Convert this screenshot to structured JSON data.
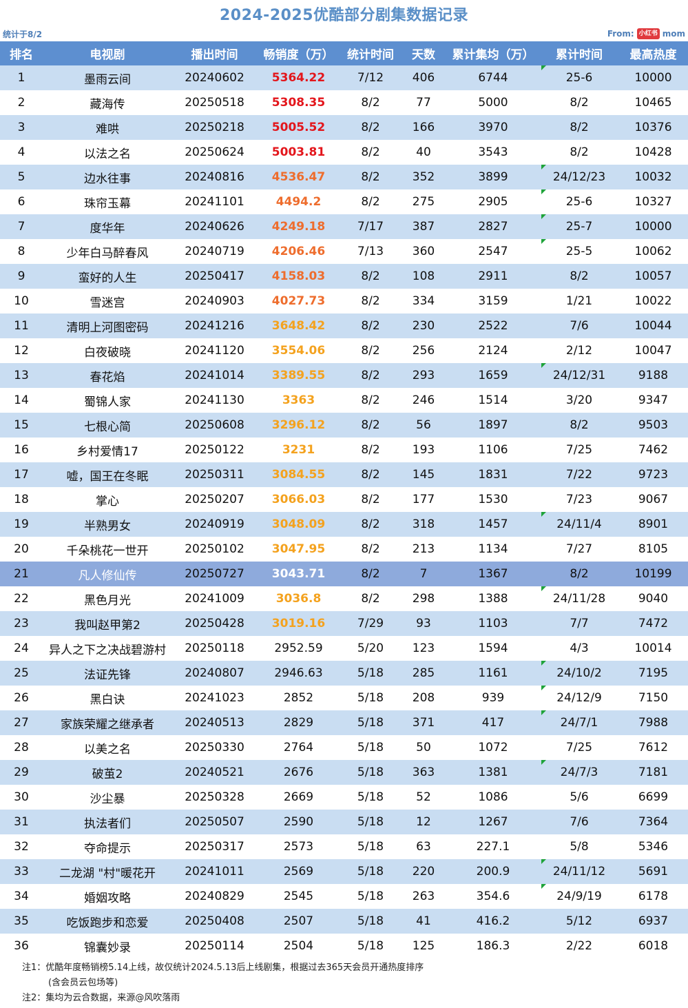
{
  "title": "2024-2025优酷部分剧集数据记录",
  "stat_date": "统计于8/2",
  "source": {
    "prefix": "From:",
    "logo_text": "小红书",
    "user": "mom"
  },
  "colors": {
    "header_bg": "#5d8fd0",
    "row_alt": "#c9ddf2",
    "highlight_row": "#8eaadc",
    "sales_red": "#e3161c",
    "sales_orange": "#ee6d2d",
    "sales_amber": "#f4a21e"
  },
  "headers": [
    "排名",
    "电视剧",
    "播出时间",
    "畅销度（万）",
    "统计时间",
    "天数",
    "累计集均（万）",
    "累计时间",
    "最高热度"
  ],
  "rows": [
    {
      "rank": "1",
      "name": "墨雨云间",
      "air": "20240602",
      "sales": "5364.22",
      "tier": "red",
      "stat": "7/12",
      "days": "406",
      "avg": "6744",
      "cum": "25-6",
      "cum_flag": true,
      "heat": "10000"
    },
    {
      "rank": "2",
      "name": "藏海传",
      "air": "20250518",
      "sales": "5308.35",
      "tier": "red",
      "stat": "8/2",
      "days": "77",
      "avg": "5000",
      "cum": "8/2",
      "cum_flag": false,
      "heat": "10465"
    },
    {
      "rank": "3",
      "name": "难哄",
      "air": "20250218",
      "sales": "5005.52",
      "tier": "red",
      "stat": "8/2",
      "days": "166",
      "avg": "3970",
      "cum": "8/2",
      "cum_flag": false,
      "heat": "10376"
    },
    {
      "rank": "4",
      "name": "以法之名",
      "air": "20250624",
      "sales": "5003.81",
      "tier": "red",
      "stat": "8/2",
      "days": "40",
      "avg": "3543",
      "cum": "8/2",
      "cum_flag": false,
      "heat": "10428"
    },
    {
      "rank": "5",
      "name": "边水往事",
      "air": "20240816",
      "sales": "4536.47",
      "tier": "orange",
      "stat": "8/2",
      "days": "352",
      "avg": "3899",
      "cum": "24/12/23",
      "cum_flag": true,
      "heat": "10032"
    },
    {
      "rank": "6",
      "name": "珠帘玉幕",
      "air": "20241101",
      "sales": "4494.2",
      "tier": "orange",
      "stat": "8/2",
      "days": "275",
      "avg": "2905",
      "cum": "25-6",
      "cum_flag": true,
      "heat": "10327"
    },
    {
      "rank": "7",
      "name": "度华年",
      "air": "20240626",
      "sales": "4249.18",
      "tier": "orange",
      "stat": "7/17",
      "days": "387",
      "avg": "2827",
      "cum": "25-7",
      "cum_flag": true,
      "heat": "10000"
    },
    {
      "rank": "8",
      "name": "少年白马醉春风",
      "air": "20240719",
      "sales": "4206.46",
      "tier": "orange",
      "stat": "7/13",
      "days": "360",
      "avg": "2547",
      "cum": "25-5",
      "cum_flag": true,
      "heat": "10062"
    },
    {
      "rank": "9",
      "name": "蛮好的人生",
      "air": "20250417",
      "sales": "4158.03",
      "tier": "orange",
      "stat": "8/2",
      "days": "108",
      "avg": "2911",
      "cum": "8/2",
      "cum_flag": false,
      "heat": "10057"
    },
    {
      "rank": "10",
      "name": "雪迷宫",
      "air": "20240903",
      "sales": "4027.73",
      "tier": "orange",
      "stat": "8/2",
      "days": "334",
      "avg": "3159",
      "cum": "1/21",
      "cum_flag": false,
      "heat": "10022"
    },
    {
      "rank": "11",
      "name": "清明上河图密码",
      "air": "20241216",
      "sales": "3648.42",
      "tier": "amber",
      "stat": "8/2",
      "days": "230",
      "avg": "2522",
      "cum": "7/6",
      "cum_flag": false,
      "heat": "10044"
    },
    {
      "rank": "12",
      "name": "白夜破晓",
      "air": "20241120",
      "sales": "3554.06",
      "tier": "amber",
      "stat": "8/2",
      "days": "256",
      "avg": "2124",
      "cum": "2/12",
      "cum_flag": false,
      "heat": "10047"
    },
    {
      "rank": "13",
      "name": "春花焰",
      "air": "20241014",
      "sales": "3389.55",
      "tier": "amber",
      "stat": "8/2",
      "days": "293",
      "avg": "1659",
      "cum": "24/12/31",
      "cum_flag": true,
      "heat": "9188"
    },
    {
      "rank": "14",
      "name": "蜀锦人家",
      "air": "20241130",
      "sales": "3363",
      "tier": "amber",
      "stat": "8/2",
      "days": "246",
      "avg": "1514",
      "cum": "3/20",
      "cum_flag": false,
      "heat": "9347"
    },
    {
      "rank": "15",
      "name": "七根心简",
      "air": "20250608",
      "sales": "3296.12",
      "tier": "amber",
      "stat": "8/2",
      "days": "56",
      "avg": "1897",
      "cum": "8/2",
      "cum_flag": false,
      "heat": "9503"
    },
    {
      "rank": "16",
      "name": "乡村爱情17",
      "air": "20250122",
      "sales": "3231",
      "tier": "amber",
      "stat": "8/2",
      "days": "193",
      "avg": "1106",
      "cum": "7/25",
      "cum_flag": false,
      "heat": "7462"
    },
    {
      "rank": "17",
      "name": "嘘，国王在冬眠",
      "air": "20250311",
      "sales": "3084.55",
      "tier": "amber",
      "stat": "8/2",
      "days": "145",
      "avg": "1831",
      "cum": "7/22",
      "cum_flag": false,
      "heat": "9723"
    },
    {
      "rank": "18",
      "name": "掌心",
      "air": "20250207",
      "sales": "3066.03",
      "tier": "amber",
      "stat": "8/2",
      "days": "177",
      "avg": "1530",
      "cum": "7/23",
      "cum_flag": false,
      "heat": "9067"
    },
    {
      "rank": "19",
      "name": "半熟男女",
      "air": "20240919",
      "sales": "3048.09",
      "tier": "amber",
      "stat": "8/2",
      "days": "318",
      "avg": "1457",
      "cum": "24/11/4",
      "cum_flag": true,
      "heat": "8901"
    },
    {
      "rank": "20",
      "name": "千朵桃花一世开",
      "air": "20250102",
      "sales": "3047.95",
      "tier": "amber",
      "stat": "8/2",
      "days": "213",
      "avg": "1134",
      "cum": "7/27",
      "cum_flag": false,
      "heat": "8105"
    },
    {
      "rank": "21",
      "name": "凡人修仙传",
      "air": "20250727",
      "sales": "3043.71",
      "tier": "amber",
      "stat": "8/2",
      "days": "7",
      "avg": "1367",
      "cum": "8/2",
      "cum_flag": false,
      "heat": "10199",
      "highlight": true
    },
    {
      "rank": "22",
      "name": "黑色月光",
      "air": "20241009",
      "sales": "3036.8",
      "tier": "amber",
      "stat": "8/2",
      "days": "298",
      "avg": "1388",
      "cum": "24/11/28",
      "cum_flag": true,
      "heat": "9040"
    },
    {
      "rank": "23",
      "name": "我叫赵甲第2",
      "air": "20250428",
      "sales": "3019.16",
      "tier": "amber",
      "stat": "7/29",
      "days": "93",
      "avg": "1103",
      "cum": "7/7",
      "cum_flag": false,
      "heat": "7472"
    },
    {
      "rank": "24",
      "name": "异人之下之决战碧游村",
      "air": "20250118",
      "sales": "2952.59",
      "tier": "plain",
      "stat": "5/20",
      "days": "123",
      "avg": "1594",
      "cum": "4/3",
      "cum_flag": false,
      "heat": "10014"
    },
    {
      "rank": "25",
      "name": "法证先锋",
      "air": "20240807",
      "sales": "2946.63",
      "tier": "plain",
      "stat": "5/18",
      "days": "285",
      "avg": "1161",
      "cum": "24/10/2",
      "cum_flag": true,
      "heat": "7195"
    },
    {
      "rank": "26",
      "name": "黑白诀",
      "air": "20241023",
      "sales": "2852",
      "tier": "plain",
      "stat": "5/18",
      "days": "208",
      "avg": "939",
      "cum": "24/12/9",
      "cum_flag": true,
      "heat": "7150"
    },
    {
      "rank": "27",
      "name": "家族荣耀之继承者",
      "air": "20240513",
      "sales": "2829",
      "tier": "plain",
      "stat": "5/18",
      "days": "371",
      "avg": "417",
      "cum": "24/7/1",
      "cum_flag": true,
      "heat": "7988"
    },
    {
      "rank": "28",
      "name": "以美之名",
      "air": "20250330",
      "sales": "2764",
      "tier": "plain",
      "stat": "5/18",
      "days": "50",
      "avg": "1072",
      "cum": "7/25",
      "cum_flag": false,
      "heat": "7612"
    },
    {
      "rank": "29",
      "name": "破茧2",
      "air": "20240521",
      "sales": "2676",
      "tier": "plain",
      "stat": "5/18",
      "days": "363",
      "avg": "1381",
      "cum": "24/7/3",
      "cum_flag": true,
      "heat": "7181"
    },
    {
      "rank": "30",
      "name": "沙尘暴",
      "air": "20250328",
      "sales": "2669",
      "tier": "plain",
      "stat": "5/18",
      "days": "52",
      "avg": "1086",
      "cum": "5/6",
      "cum_flag": false,
      "heat": "6699"
    },
    {
      "rank": "31",
      "name": "执法者们",
      "air": "20250507",
      "sales": "2590",
      "tier": "plain",
      "stat": "5/18",
      "days": "12",
      "avg": "1267",
      "cum": "7/6",
      "cum_flag": false,
      "heat": "7364"
    },
    {
      "rank": "32",
      "name": "夺命提示",
      "air": "20250317",
      "sales": "2573",
      "tier": "plain",
      "stat": "5/18",
      "days": "63",
      "avg": "227.1",
      "cum": "5/8",
      "cum_flag": false,
      "heat": "5346"
    },
    {
      "rank": "33",
      "name": "二龙湖 \"村\"暖花开",
      "air": "20241011",
      "sales": "2569",
      "tier": "plain",
      "stat": "5/18",
      "days": "220",
      "avg": "200.9",
      "cum": "24/11/12",
      "cum_flag": true,
      "heat": "5691"
    },
    {
      "rank": "34",
      "name": "婚姻攻略",
      "air": "20240829",
      "sales": "2545",
      "tier": "plain",
      "stat": "5/18",
      "days": "263",
      "avg": "354.6",
      "cum": "24/9/19",
      "cum_flag": true,
      "heat": "6178"
    },
    {
      "rank": "35",
      "name": "吃饭跑步和恋爱",
      "air": "20250408",
      "sales": "2507",
      "tier": "plain",
      "stat": "5/18",
      "days": "41",
      "avg": "416.2",
      "cum": "5/12",
      "cum_flag": false,
      "heat": "6937"
    },
    {
      "rank": "36",
      "name": "锦囊妙录",
      "air": "20250114",
      "sales": "2504",
      "tier": "plain",
      "stat": "5/18",
      "days": "125",
      "avg": "186.3",
      "cum": "2/22",
      "cum_flag": false,
      "heat": "6018"
    }
  ],
  "notes": {
    "note1": "注1：优酷年度畅销榜5.14上线，故仅统计2024.5.13后上线剧集，根据过去365天会员开通热度排序",
    "note1_cont": "(含会员云包场等)",
    "note2": "注2：集均为云合数据，来源@风吹落雨"
  }
}
